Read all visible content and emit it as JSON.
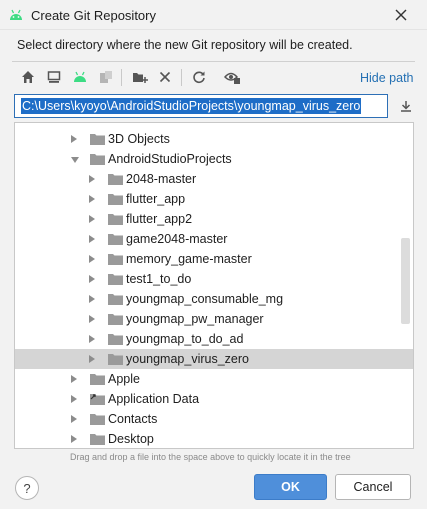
{
  "window": {
    "title": "Create Git Repository",
    "app_icon": "android-icon",
    "accent_color": "#3ddc84"
  },
  "instruction": "Select directory where the new Git repository will be created.",
  "toolbar": {
    "buttons": [
      "home-icon",
      "desktop-icon",
      "android-module-icon",
      "project-icon",
      "new-folder-icon",
      "delete-icon",
      "refresh-icon",
      "show-hidden-icon"
    ],
    "hide_path_label": "Hide path"
  },
  "path": {
    "value": "C:\\Users\\kyoyo\\AndroidStudioProjects\\youngmap_virus_zero"
  },
  "tree": {
    "items": [
      {
        "label": "3D Objects",
        "expanded": false,
        "level": 0
      },
      {
        "label": "AndroidStudioProjects",
        "expanded": true,
        "level": 0
      },
      {
        "label": "2048-master",
        "expanded": false,
        "level": 1
      },
      {
        "label": "flutter_app",
        "expanded": false,
        "level": 1
      },
      {
        "label": "flutter_app2",
        "expanded": false,
        "level": 1
      },
      {
        "label": "game2048-master",
        "expanded": false,
        "level": 1
      },
      {
        "label": "memory_game-master",
        "expanded": false,
        "level": 1
      },
      {
        "label": "test1_to_do",
        "expanded": false,
        "level": 1
      },
      {
        "label": "youngmap_consumable_mg",
        "expanded": false,
        "level": 1
      },
      {
        "label": "youngmap_pw_manager",
        "expanded": false,
        "level": 1
      },
      {
        "label": "youngmap_to_do_ad",
        "expanded": false,
        "level": 1
      },
      {
        "label": "youngmap_virus_zero",
        "expanded": false,
        "level": 1,
        "selected": true
      },
      {
        "label": "Apple",
        "expanded": false,
        "level": -1
      },
      {
        "label": "Application Data",
        "expanded": false,
        "level": -1,
        "shortcut": true
      },
      {
        "label": "Contacts",
        "expanded": false,
        "level": -1
      },
      {
        "label": "Desktop",
        "expanded": false,
        "level": -1
      }
    ]
  },
  "hint": "Drag and drop a file into the space above to quickly locate it in the tree",
  "footer": {
    "help_label": "?",
    "ok_label": "OK",
    "cancel_label": "Cancel"
  }
}
